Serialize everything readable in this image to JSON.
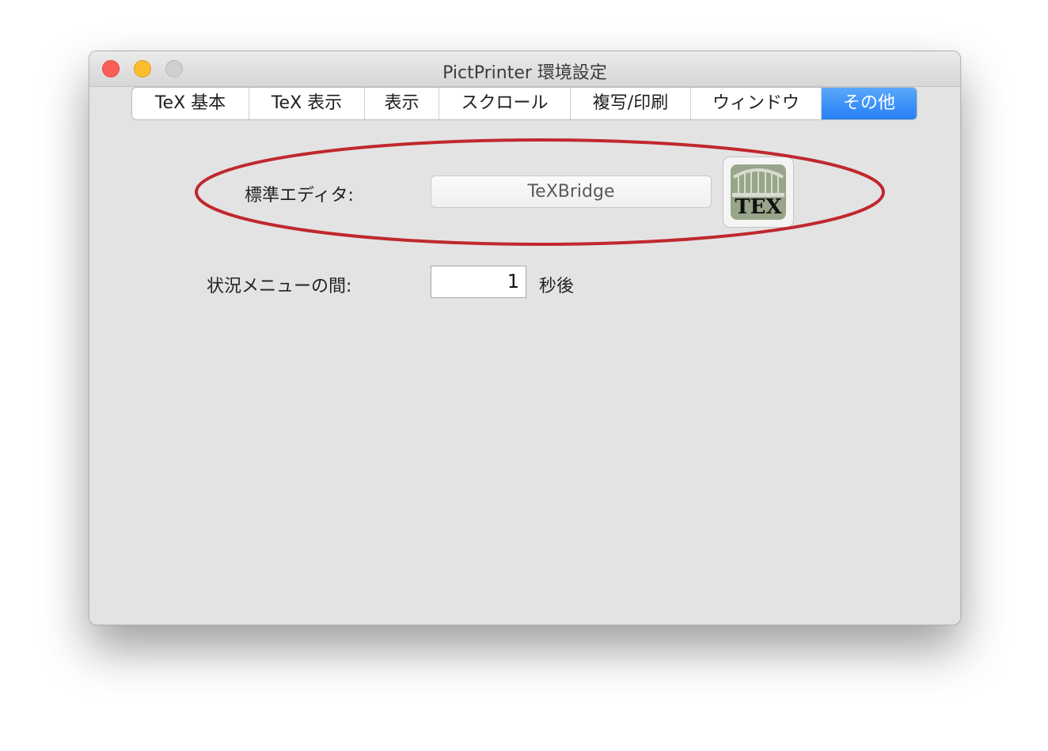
{
  "window": {
    "title": "PictPrinter 環境設定"
  },
  "tabs": [
    {
      "label": "TeX 基本",
      "active": false
    },
    {
      "label": "TeX 表示",
      "active": false
    },
    {
      "label": "表示",
      "active": false
    },
    {
      "label": "スクロール",
      "active": false
    },
    {
      "label": "複写/印刷",
      "active": false
    },
    {
      "label": "ウィンドウ",
      "active": false
    },
    {
      "label": "その他",
      "active": true
    }
  ],
  "settings": {
    "editor_label": "標準エディタ:",
    "editor_value": "TeXBridge",
    "editor_icon": "texbridge-app-icon",
    "editor_icon_text": "TEX",
    "status_menu_label": "状況メニューの間:",
    "status_menu_value": "1",
    "status_menu_unit": "秒後"
  },
  "colors": {
    "accent": "#2680f5",
    "annotation": "#c0282d",
    "close": "#fc5f57",
    "minimize": "#fdbc2e"
  }
}
